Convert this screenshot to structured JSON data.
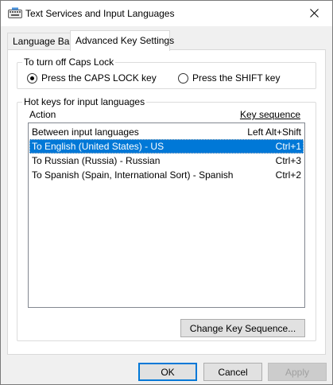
{
  "window": {
    "title": "Text Services and Input Languages"
  },
  "tabs": [
    {
      "label": "Language Bar",
      "active": false
    },
    {
      "label": "Advanced Key Settings",
      "active": true
    }
  ],
  "caps_lock": {
    "group_title": "To turn off Caps Lock",
    "option_caps": "Press the CAPS LOCK key",
    "option_shift": "Press the SHIFT key",
    "selected": "caps"
  },
  "hotkeys": {
    "group_title": "Hot keys for input languages",
    "col_action": "Action",
    "col_sequence": "Key sequence",
    "rows": [
      {
        "action": "Between input languages",
        "sequence": "Left Alt+Shift",
        "selected": false
      },
      {
        "action": "To English (United States) - US",
        "sequence": "Ctrl+1",
        "selected": true
      },
      {
        "action": "To Russian (Russia) - Russian",
        "sequence": "Ctrl+3",
        "selected": false
      },
      {
        "action": "To Spanish (Spain, International Sort) - Spanish",
        "sequence": "Ctrl+2",
        "selected": false
      }
    ],
    "change_button": "Change Key Sequence..."
  },
  "buttons": {
    "ok": "OK",
    "cancel": "Cancel",
    "apply": "Apply"
  },
  "colors": {
    "selection": "#0078d7",
    "default_button_border": "#0078d7"
  },
  "icons": {
    "app": "keyboard-icon",
    "close": "close-icon"
  }
}
